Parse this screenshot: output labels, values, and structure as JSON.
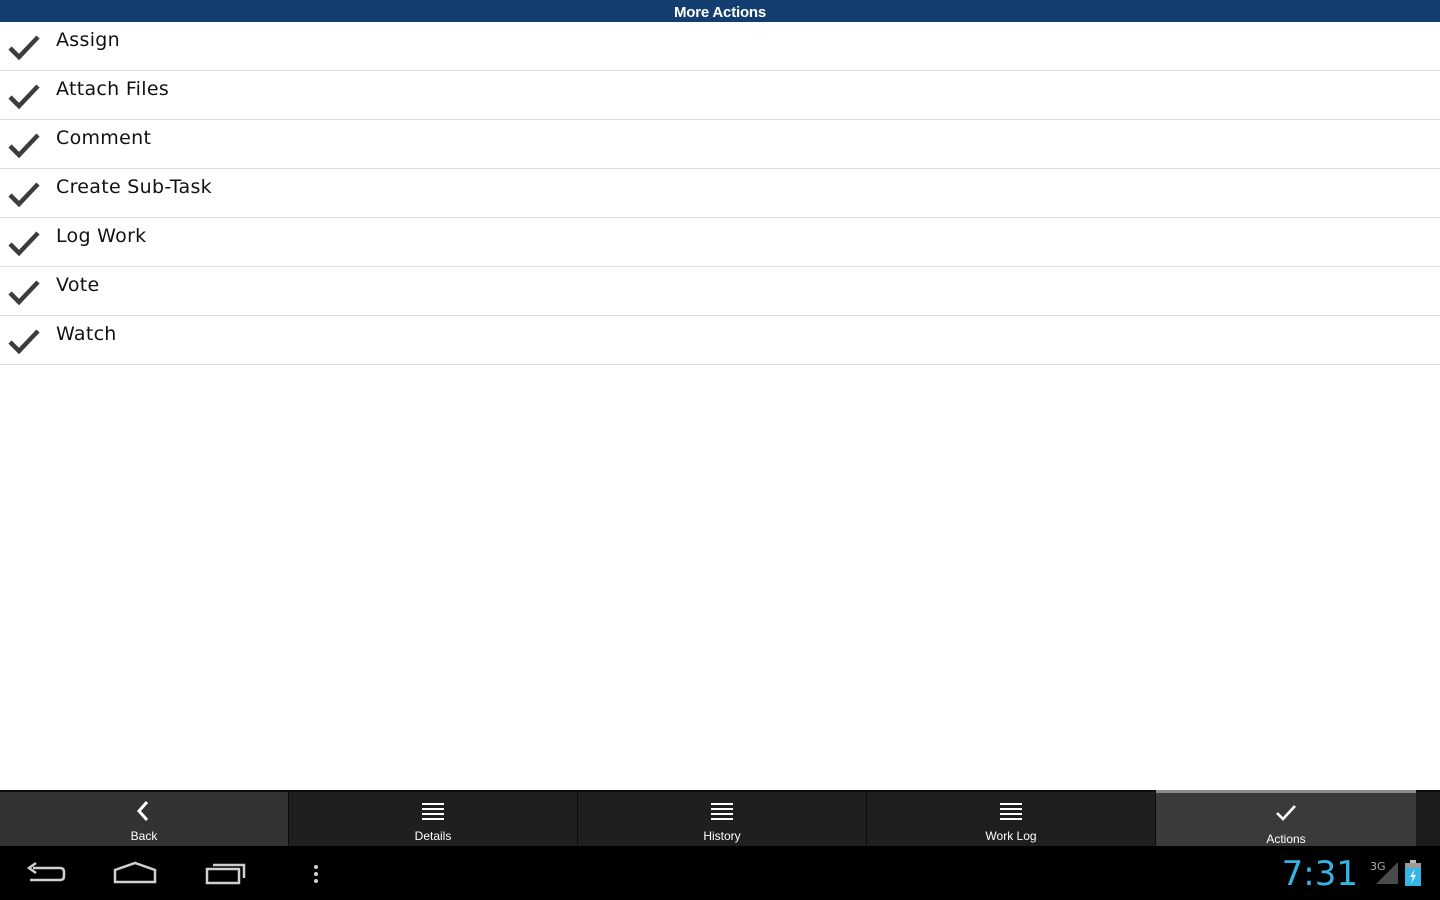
{
  "header": {
    "title": "More Actions"
  },
  "actions": [
    {
      "label": "Assign"
    },
    {
      "label": "Attach Files"
    },
    {
      "label": "Comment"
    },
    {
      "label": "Create Sub-Task"
    },
    {
      "label": "Log Work"
    },
    {
      "label": "Vote"
    },
    {
      "label": "Watch"
    }
  ],
  "tabs": [
    {
      "label": "Back",
      "icon": "chevron-left-icon"
    },
    {
      "label": "Details",
      "icon": "list-icon"
    },
    {
      "label": "History",
      "icon": "list-icon"
    },
    {
      "label": "Work Log",
      "icon": "list-icon"
    },
    {
      "label": "Actions",
      "icon": "checkmark-icon",
      "selected": true
    }
  ],
  "system": {
    "time": "7:31",
    "network": "3G",
    "nav": [
      "back-icon",
      "home-icon",
      "recent-apps-icon",
      "menu-icon"
    ]
  },
  "colors": {
    "header_bg": "#133e6f",
    "accent": "#33b5e5",
    "check": "#3c3c3c"
  }
}
